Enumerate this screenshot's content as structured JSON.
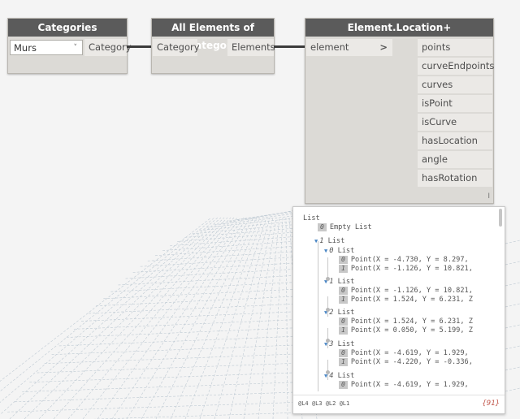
{
  "nodes": {
    "categories": {
      "title": "Categories",
      "dropdown_value": "Murs",
      "output_port": "Category"
    },
    "all_elements": {
      "title": "All Elements of Category",
      "input_port": "Category",
      "output_port": "Elements"
    },
    "element_location": {
      "title": "Element.Location+",
      "input_port": "element",
      "input_chevron": ">",
      "outputs": [
        "points",
        "curveEndpoints",
        "curves",
        "isPoint",
        "isCurve",
        "hasLocation",
        "angle",
        "hasRotation"
      ],
      "footer_mark": "I"
    }
  },
  "preview": {
    "root_label": "List",
    "rows": [
      {
        "kind": "item",
        "index": "0",
        "text": "Empty List"
      },
      {
        "kind": "list",
        "index": "1",
        "text": "List"
      },
      {
        "kind": "list",
        "index": "0",
        "text": "List"
      },
      {
        "kind": "item",
        "index": "0",
        "text": "Point(X = -4.730, Y = 8.297,"
      },
      {
        "kind": "item",
        "index": "1",
        "text": "Point(X = -1.126, Y = 10.821,"
      },
      {
        "kind": "list",
        "index": "1",
        "text": "List"
      },
      {
        "kind": "item",
        "index": "0",
        "text": "Point(X = -1.126, Y = 10.821,"
      },
      {
        "kind": "item",
        "index": "1",
        "text": "Point(X = 1.524, Y = 6.231, Z"
      },
      {
        "kind": "list",
        "index": "2",
        "text": "List"
      },
      {
        "kind": "item",
        "index": "0",
        "text": "Point(X = 1.524, Y = 6.231, Z"
      },
      {
        "kind": "item",
        "index": "1",
        "text": "Point(X = 0.050, Y = 5.199, Z"
      },
      {
        "kind": "list",
        "index": "3",
        "text": "List"
      },
      {
        "kind": "item",
        "index": "0",
        "text": "Point(X = -4.619, Y = 1.929,"
      },
      {
        "kind": "item",
        "index": "1",
        "text": "Point(X = -4.220, Y = -0.336,"
      },
      {
        "kind": "list",
        "index": "4",
        "text": "List"
      },
      {
        "kind": "item",
        "index": "0",
        "text": "Point(X = -4.619, Y = 1.929,"
      }
    ],
    "levels_label": "@L4 @L3 @L2 @L1",
    "count_label": "{91}"
  },
  "colors": {
    "background": "#f4f4f4",
    "node_header": "#5b5b5b",
    "node_body": "#dcdad6",
    "wire": "#3c3c3c",
    "grid": "#bfcad3",
    "list_toggle": "#4a86c5"
  }
}
